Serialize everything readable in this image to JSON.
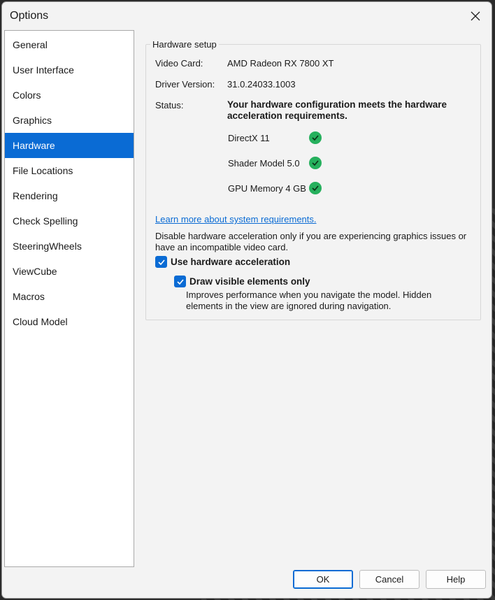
{
  "window": {
    "title": "Options"
  },
  "sidebar": {
    "items": [
      {
        "label": "General"
      },
      {
        "label": "User Interface"
      },
      {
        "label": "Colors"
      },
      {
        "label": "Graphics"
      },
      {
        "label": "Hardware",
        "selected": true
      },
      {
        "label": "File Locations"
      },
      {
        "label": "Rendering"
      },
      {
        "label": "Check Spelling"
      },
      {
        "label": "SteeringWheels"
      },
      {
        "label": "ViewCube"
      },
      {
        "label": "Macros"
      },
      {
        "label": "Cloud Model"
      }
    ]
  },
  "hardware": {
    "group_title": "Hardware setup",
    "video_card_label": "Video Card:",
    "video_card_value": "AMD Radeon RX 7800 XT",
    "driver_label": "Driver Version:",
    "driver_value": "31.0.24033.1003",
    "status_label": "Status:",
    "status_value": "Your hardware configuration meets the hardware acceleration requirements.",
    "requirements": [
      {
        "label": "DirectX 11",
        "met": true
      },
      {
        "label": "Shader Model 5.0",
        "met": true
      },
      {
        "label": "GPU Memory 4 GB",
        "met": true
      }
    ],
    "learn_more_link": "Learn more about system requirements.",
    "disable_note": "Disable hardware acceleration only if you are experiencing graphics issues or have an incompatible video card.",
    "use_hw_accel": {
      "label": "Use hardware acceleration",
      "checked": true
    },
    "draw_visible": {
      "label": "Draw visible elements only",
      "checked": true
    },
    "draw_visible_desc": "Improves performance when you navigate the model. Hidden elements in the view are ignored during navigation."
  },
  "footer": {
    "ok": "OK",
    "cancel": "Cancel",
    "help": "Help"
  },
  "colors": {
    "accent": "#0a6bd4",
    "success": "#26b05d"
  }
}
